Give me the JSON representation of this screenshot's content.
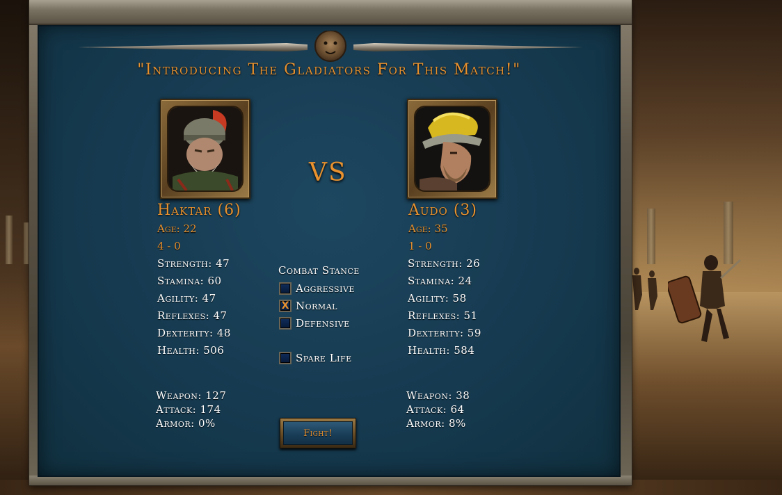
{
  "title": "\"Introducing The Gladiators For This Match!\"",
  "vs_label": "VS",
  "left": {
    "name": "Haktar (6)",
    "age": "Age: 22",
    "record": "4 - 0",
    "strength": "Strength: 47",
    "stamina": "Stamina: 60",
    "agility": "Agility: 47",
    "reflexes": "Reflexes: 47",
    "dexterity": "Dexterity: 48",
    "health": "Health: 506",
    "weapon": "Weapon: 127",
    "attack": "Attack: 174",
    "armor": "Armor: 0%"
  },
  "right": {
    "name": "Audo (3)",
    "age": "Age: 35",
    "record": "1 - 0",
    "strength": "Strength: 26",
    "stamina": "Stamina: 24",
    "agility": "Agility: 58",
    "reflexes": "Reflexes: 51",
    "dexterity": "Dexterity: 59",
    "health": "Health: 584",
    "weapon": "Weapon: 38",
    "attack": "Attack: 64",
    "armor": "Armor: 8%"
  },
  "stance": {
    "title": "Combat Stance",
    "options": [
      {
        "label": "Aggressive",
        "checked": false
      },
      {
        "label": "Normal",
        "checked": true
      },
      {
        "label": "Defensive",
        "checked": false
      }
    ],
    "spare_life": {
      "label": "Spare Life",
      "checked": false
    },
    "check_mark": "X"
  },
  "fight_button": "Fight!",
  "colors": {
    "accent": "#e8912e",
    "panel": "#163a50",
    "text": "#ffffff"
  }
}
